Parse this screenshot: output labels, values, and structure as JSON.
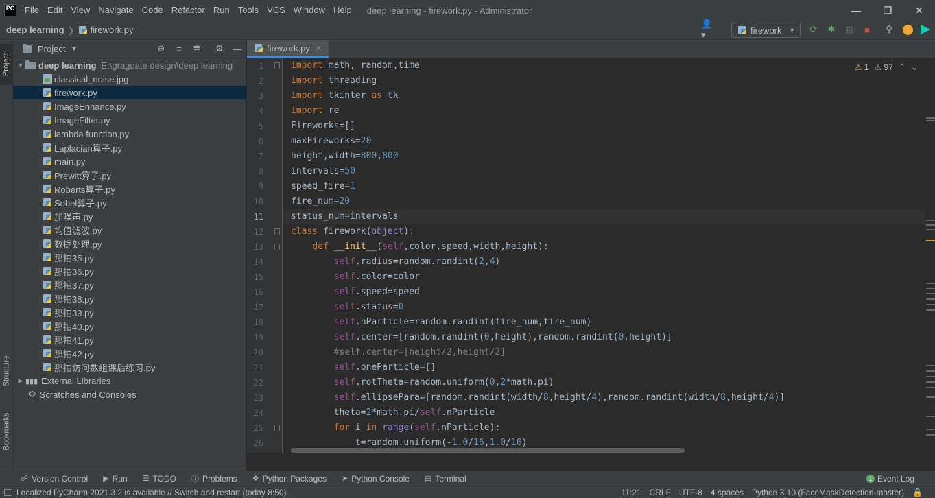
{
  "menu": {
    "items": [
      "File",
      "Edit",
      "View",
      "Navigate",
      "Code",
      "Refactor",
      "Run",
      "Tools",
      "VCS",
      "Window",
      "Help"
    ],
    "window_title": "deep learning - firework.py - Administrator",
    "logo": "PC"
  },
  "navbar": {
    "project": "deep learning",
    "file": "firework.py",
    "run_config": "firework"
  },
  "left_stripe": {
    "project": "Project",
    "structure": "Structure",
    "bookmarks": "Bookmarks"
  },
  "project_panel": {
    "title": "Project",
    "root": {
      "name": "deep learning",
      "path": "E:\\graguate design\\deep learning"
    },
    "files": [
      "classical_noise.jpg",
      "firework.py",
      "ImageEnhance.py",
      "ImageFilter.py",
      "lambda function.py",
      "Laplacian算子.py",
      "main.py",
      "Prewitt算子.py",
      "Roberts算子.py",
      "Sobel算子.py",
      "加噪声.py",
      "均值滤波.py",
      "数据处理.py",
      "那拍35.py",
      "那拍36.py",
      "那拍37.py",
      "那拍38.py",
      "那拍39.py",
      "那拍40.py",
      "那拍41.py",
      "那拍42.py",
      "那拍访问数组课后练习.py"
    ],
    "selected": "firework.py",
    "external": "External Libraries",
    "scratches": "Scratches and Consoles"
  },
  "editor": {
    "tab": "firework.py",
    "warnings": {
      "errors": "1",
      "weak": "97"
    },
    "current_line": "11",
    "line_numbers": [
      "1",
      "2",
      "3",
      "4",
      "5",
      "6",
      "7",
      "8",
      "9",
      "10",
      "11",
      "12",
      "13",
      "14",
      "15",
      "16",
      "17",
      "18",
      "19",
      "20",
      "21",
      "22",
      "23",
      "24",
      "25",
      "26"
    ],
    "lines": [
      [
        [
          "k",
          "import"
        ],
        [
          "t",
          " math, random,time"
        ]
      ],
      [
        [
          "k",
          "import"
        ],
        [
          "t",
          " threading"
        ]
      ],
      [
        [
          "k",
          "import"
        ],
        [
          "t",
          " tkinter "
        ],
        [
          "k",
          "as"
        ],
        [
          "t",
          " tk"
        ]
      ],
      [
        [
          "k",
          "import"
        ],
        [
          "t",
          " re"
        ]
      ],
      [
        [
          "t",
          "Fireworks=[]"
        ]
      ],
      [
        [
          "t",
          "maxFireworks="
        ],
        [
          "n",
          "20"
        ]
      ],
      [
        [
          "t",
          "height,width="
        ],
        [
          "n",
          "800"
        ],
        [
          "t",
          ","
        ],
        [
          "n",
          "800"
        ]
      ],
      [
        [
          "t",
          "intervals="
        ],
        [
          "n",
          "50"
        ]
      ],
      [
        [
          "t",
          "speed_fire="
        ],
        [
          "n",
          "1"
        ]
      ],
      [
        [
          "t",
          "fire_num="
        ],
        [
          "n",
          "20"
        ]
      ],
      [
        [
          "t",
          "status_num=intervals"
        ]
      ],
      [
        [
          "k",
          "class"
        ],
        [
          "t",
          " firework("
        ],
        [
          "m",
          "object"
        ],
        [
          "t",
          "):"
        ]
      ],
      [
        [
          "t",
          "    "
        ],
        [
          "k",
          "def"
        ],
        [
          "t",
          " "
        ],
        [
          "f",
          "__init__"
        ],
        [
          "t",
          "("
        ],
        [
          "s",
          "self"
        ],
        [
          "t",
          ",color,speed,width,height):"
        ]
      ],
      [
        [
          "t",
          "        "
        ],
        [
          "s",
          "self"
        ],
        [
          "t",
          ".radius=random.randint("
        ],
        [
          "n",
          "2"
        ],
        [
          "t",
          ","
        ],
        [
          "n",
          "4"
        ],
        [
          "t",
          ")"
        ]
      ],
      [
        [
          "t",
          "        "
        ],
        [
          "s",
          "self"
        ],
        [
          "t",
          ".color=color"
        ]
      ],
      [
        [
          "t",
          "        "
        ],
        [
          "s",
          "self"
        ],
        [
          "t",
          ".speed=speed"
        ]
      ],
      [
        [
          "t",
          "        "
        ],
        [
          "s",
          "self"
        ],
        [
          "t",
          ".status="
        ],
        [
          "n",
          "0"
        ]
      ],
      [
        [
          "t",
          "        "
        ],
        [
          "s",
          "self"
        ],
        [
          "t",
          ".nParticle=random.randint(fire_num,fire_num)"
        ]
      ],
      [
        [
          "t",
          "        "
        ],
        [
          "s",
          "self"
        ],
        [
          "t",
          ".center=[random.randint("
        ],
        [
          "n",
          "0"
        ],
        [
          "t",
          ",height),random.randint("
        ],
        [
          "n",
          "0"
        ],
        [
          "t",
          ",height)]"
        ]
      ],
      [
        [
          "t",
          "        "
        ],
        [
          "c",
          "#self.center=[height/2,height/2]"
        ]
      ],
      [
        [
          "t",
          "        "
        ],
        [
          "s",
          "self"
        ],
        [
          "t",
          ".oneParticle=[]"
        ]
      ],
      [
        [
          "t",
          "        "
        ],
        [
          "s",
          "self"
        ],
        [
          "t",
          ".rotTheta=random.uniform("
        ],
        [
          "n",
          "0"
        ],
        [
          "t",
          ","
        ],
        [
          "n",
          "2"
        ],
        [
          "t",
          "*math.pi)"
        ]
      ],
      [
        [
          "t",
          "        "
        ],
        [
          "s",
          "self"
        ],
        [
          "t",
          ".ellipsePara=[random.randint(width/"
        ],
        [
          "n",
          "8"
        ],
        [
          "t",
          ",height/"
        ],
        [
          "n",
          "4"
        ],
        [
          "t",
          "),random.randint(width/"
        ],
        [
          "n",
          "8"
        ],
        [
          "t",
          ",height/"
        ],
        [
          "n",
          "4"
        ],
        [
          "t",
          ")]"
        ]
      ],
      [
        [
          "t",
          "        theta="
        ],
        [
          "n",
          "2"
        ],
        [
          "t",
          "*math.pi/"
        ],
        [
          "s",
          "self"
        ],
        [
          "t",
          ".nParticle"
        ]
      ],
      [
        [
          "t",
          "        "
        ],
        [
          "k",
          "for"
        ],
        [
          "t",
          " i "
        ],
        [
          "k",
          "in"
        ],
        [
          "t",
          " "
        ],
        [
          "m",
          "range"
        ],
        [
          "t",
          "("
        ],
        [
          "s",
          "self"
        ],
        [
          "t",
          ".nParticle):"
        ]
      ],
      [
        [
          "t",
          "            t=random.uniform(-"
        ],
        [
          "n",
          "1.0"
        ],
        [
          "t",
          "/"
        ],
        [
          "n",
          "16"
        ],
        [
          "t",
          ","
        ],
        [
          "n",
          "1.0"
        ],
        [
          "t",
          "/"
        ],
        [
          "n",
          "16"
        ],
        [
          "t",
          ")"
        ]
      ]
    ]
  },
  "bottom_tools": [
    "Version Control",
    "Run",
    "TODO",
    "Problems",
    "Python Packages",
    "Python Console",
    "Terminal"
  ],
  "event_log": "Event Log",
  "status": {
    "message": "Localized PyCharm 2021.3.2 is available // Switch and restart (today 8:50)",
    "position": "11:21",
    "line_sep": "CRLF",
    "encoding": "UTF-8",
    "indent": "4 spaces",
    "interpreter": "Python 3.10 (FaceMaskDetection-master)"
  }
}
